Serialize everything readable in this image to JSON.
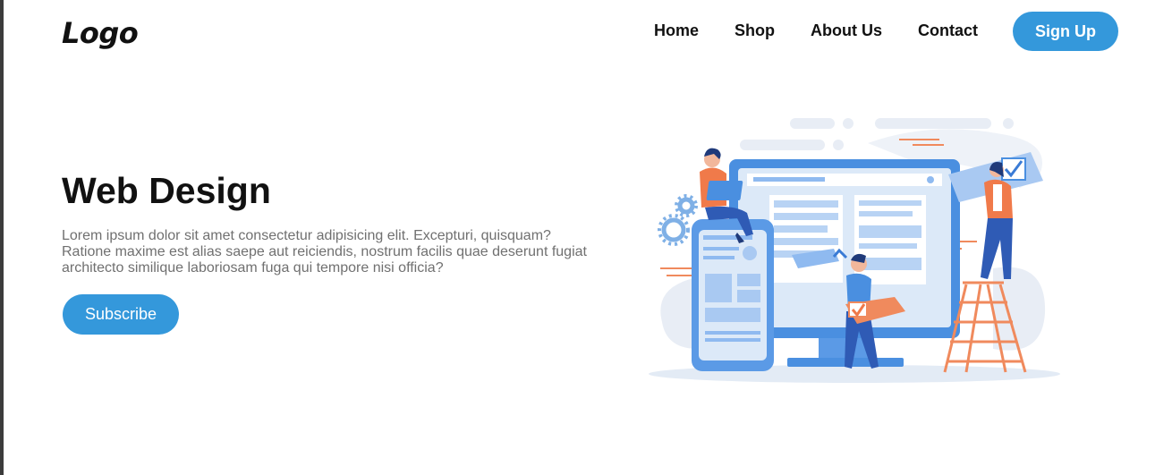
{
  "header": {
    "logo": "Logo",
    "nav": [
      {
        "label": "Home"
      },
      {
        "label": "Shop"
      },
      {
        "label": "About Us"
      },
      {
        "label": "Contact"
      }
    ],
    "signup_label": "Sign Up"
  },
  "hero": {
    "title": "Web Design",
    "text": "Lorem ipsum dolor sit amet consectetur adipisicing elit. Excepturi, quisquam? Ratione maxime est alias saepe aut reiciendis, nostrum facilis quae deserunt fugiat architecto similique laboriosam fuga qui tempore nisi officia?",
    "subscribe_label": "Subscribe"
  },
  "colors": {
    "accent": "#3498db",
    "text_dark": "#111111",
    "text_muted": "#707070"
  }
}
